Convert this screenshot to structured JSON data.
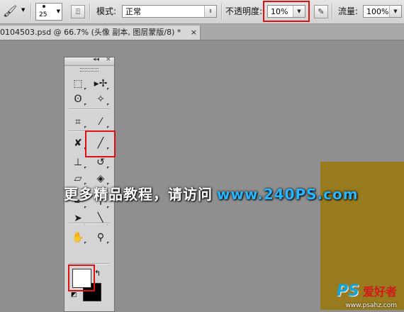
{
  "options_bar": {
    "brush_size": "25",
    "mode_label": "模式:",
    "mode_value": "正常",
    "opacity_label": "不透明度:",
    "opacity_value": "10%",
    "flow_label": "流量:",
    "flow_value": "100%"
  },
  "document_tab": {
    "title": "0104503.psd @ 66.7% (头像 副本, 图层蒙版/8) *",
    "close": "×"
  },
  "toolbox": {
    "collapse_glyph": "◂◂",
    "close_glyph": "×",
    "tools": [
      {
        "name": "marquee-tool-icon",
        "glyph": "⬚"
      },
      {
        "name": "move-tool-icon",
        "glyph": "▸✢"
      },
      {
        "name": "lasso-tool-icon",
        "glyph": "ʘ"
      },
      {
        "name": "magic-wand-tool-icon",
        "glyph": "✧"
      },
      {
        "name": "crop-tool-icon",
        "glyph": "⌗"
      },
      {
        "name": "eyedropper-tool-icon",
        "glyph": "⁄"
      },
      {
        "name": "healing-brush-tool-icon",
        "glyph": "✘"
      },
      {
        "name": "brush-tool-icon",
        "glyph": "╱"
      },
      {
        "name": "clone-stamp-tool-icon",
        "glyph": "⊥"
      },
      {
        "name": "history-brush-tool-icon",
        "glyph": "↺"
      },
      {
        "name": "eraser-tool-icon",
        "glyph": "▱"
      },
      {
        "name": "paint-bucket-tool-icon",
        "glyph": "◈"
      },
      {
        "name": "pen-tool-icon",
        "glyph": "✒"
      },
      {
        "name": "type-tool-icon",
        "glyph": "T"
      },
      {
        "name": "path-selection-tool-icon",
        "glyph": "➤"
      },
      {
        "name": "line-tool-icon",
        "glyph": "╲"
      },
      {
        "name": "hand-tool-icon",
        "glyph": "✋"
      },
      {
        "name": "zoom-tool-icon",
        "glyph": "⚲"
      }
    ]
  },
  "overlay": {
    "watermark_text": "更多精品教程，请访问",
    "watermark_url": "www.240PS.com",
    "logo_ps": "PS",
    "logo_cn": "爱好者",
    "logo_url": "www.psahz.com"
  },
  "colors": {
    "foreground": "#ffffff",
    "background": "#000000",
    "canvas_gold": "#987b1f",
    "highlight": "#e01010"
  }
}
